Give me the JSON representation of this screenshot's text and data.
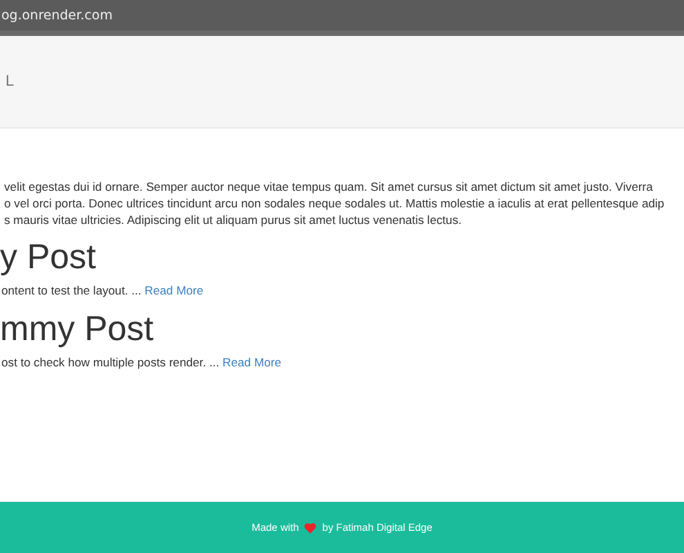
{
  "address_bar": {
    "url": "og.onrender.com"
  },
  "header": {
    "logo": "L"
  },
  "intro": {
    "lines": [
      "velit egestas dui id ornare. Semper auctor neque vitae tempus quam. Sit amet cursus sit amet dictum sit amet justo. Viverra",
      "o vel orci porta. Donec ultrices tincidunt arcu non sodales neque sodales ut. Mattis molestie a iaculis at erat pellentesque adip",
      "s mauris vitae ultricies. Adipiscing elit ut aliquam purus sit amet luctus venenatis lectus."
    ]
  },
  "posts": [
    {
      "title": "y Post",
      "excerpt": "ontent to test the layout. ...",
      "link": "Read More"
    },
    {
      "title": "mmy Post",
      "excerpt": "ost to check how multiple posts render. ...",
      "link": "Read More"
    }
  ],
  "footer": {
    "before": "Made with",
    "after": "by Fatimah Digital Edge"
  }
}
